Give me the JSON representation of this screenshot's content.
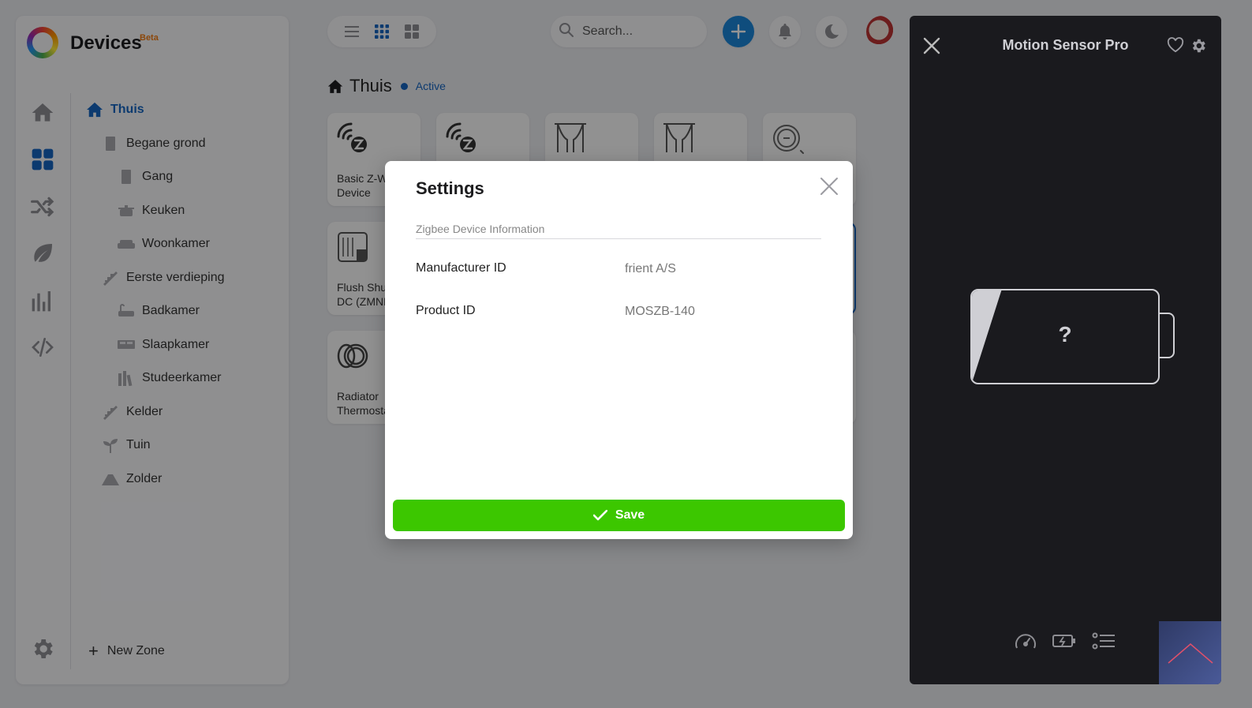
{
  "app": {
    "title": "Devices",
    "badge": "Beta",
    "accent": "#1565c0",
    "badge_color": "#f07b12"
  },
  "rail": [
    {
      "name": "home-nav-icon",
      "icon": "home"
    },
    {
      "name": "devices-nav-icon",
      "icon": "grid",
      "active": true
    },
    {
      "name": "flows-nav-icon",
      "icon": "shuffle"
    },
    {
      "name": "energy-nav-icon",
      "icon": "leaf"
    },
    {
      "name": "insights-nav-icon",
      "icon": "bar-chart"
    },
    {
      "name": "developer-nav-icon",
      "icon": "code"
    }
  ],
  "zones": [
    {
      "label": "Thuis",
      "icon": "home",
      "active": true
    },
    {
      "label": "Begane grond",
      "icon": "door"
    },
    {
      "label": "Gang",
      "icon": "door"
    },
    {
      "label": "Keuken",
      "icon": "pot"
    },
    {
      "label": "Woonkamer",
      "icon": "sofa"
    },
    {
      "label": "Eerste verdieping",
      "icon": "stairs"
    },
    {
      "label": "Badkamer",
      "icon": "bath"
    },
    {
      "label": "Slaapkamer",
      "icon": "bed"
    },
    {
      "label": "Studeerkamer",
      "icon": "books"
    },
    {
      "label": "Kelder",
      "icon": "stairs"
    },
    {
      "label": "Tuin",
      "icon": "garden"
    },
    {
      "label": "Zolder",
      "icon": "attic"
    }
  ],
  "new_zone_label": "New Zone",
  "search": {
    "placeholder": "Search..."
  },
  "zone": {
    "title": "Thuis",
    "status": "Active"
  },
  "tiles": [
    {
      "label": "Basic Z-Wave Device",
      "icon": "zwave"
    },
    {
      "label": "",
      "icon": "zwave"
    },
    {
      "label": "",
      "icon": "curtains"
    },
    {
      "label": "",
      "icon": "curtains"
    },
    {
      "label": "",
      "icon": "thermostat-dial"
    },
    {
      "label": "Flush Shutter DC (ZMNHOD)",
      "icon": "flush-module"
    },
    {
      "label": "Radiator Thermostat",
      "icon": "radiator-knob"
    }
  ],
  "device_panel": {
    "title": "Motion Sensor Pro",
    "battery_value": "?"
  },
  "modal": {
    "title": "Settings",
    "section": "Zigbee Device Information",
    "rows": [
      {
        "label": "Manufacturer ID",
        "value": "frient A/S"
      },
      {
        "label": "Product ID",
        "value": "MOSZB-140"
      }
    ],
    "save_label": "Save",
    "save_color": "#3cc700"
  }
}
